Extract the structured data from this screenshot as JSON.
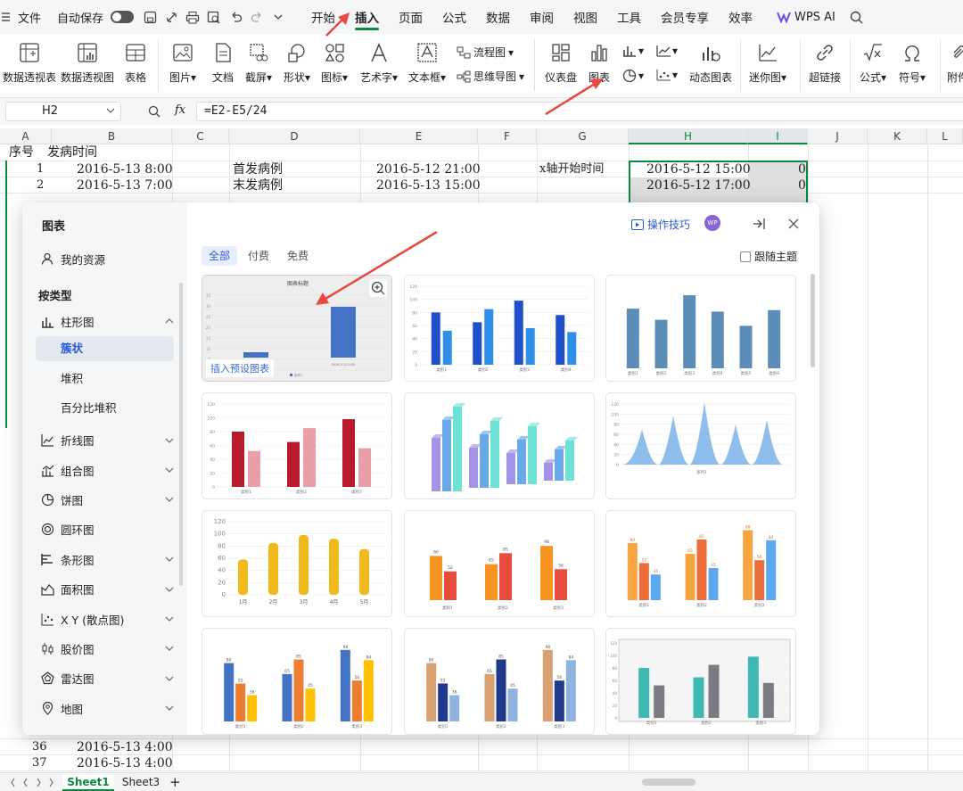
{
  "menubar": {
    "file": "文件",
    "autosave": "自动保存",
    "tabs": [
      "开始",
      "插入",
      "页面",
      "公式",
      "数据",
      "审阅",
      "视图",
      "工具",
      "会员专享",
      "效率"
    ],
    "active_tab": "插入",
    "wps_ai": "WPS AI"
  },
  "ribbon": {
    "pivot_table": "数据透视表",
    "pivot_chart": "数据透视图",
    "table": "表格",
    "picture": "图片",
    "document": "文档",
    "screenshot": "截屏",
    "shape": "形状",
    "icon": "图标",
    "art_text": "艺术字",
    "textbox": "文本框",
    "flowchart": "流程图",
    "mindmap": "思维导图",
    "dashboard": "仪表盘",
    "chart": "图表",
    "dynamic_chart": "动态图表",
    "sparkline": "迷你图",
    "hyperlink": "超链接",
    "formula": "公式",
    "symbol": "符号",
    "attachment": "附件"
  },
  "formula_bar": {
    "cell_ref": "H2",
    "fx": "fx",
    "formula": "=E2-E5/24"
  },
  "columns": [
    "A",
    "B",
    "C",
    "D",
    "E",
    "F",
    "G",
    "H",
    "I",
    "J",
    "K",
    "L"
  ],
  "cells": {
    "a1": "序号",
    "b1": "发病时间",
    "a2": "1",
    "b2": "2016-5-13  8:00",
    "d2": "首发病例",
    "e2": "2016-5-12 21:00",
    "g2": "x轴开始时间",
    "h2": "2016-5-12 15:00",
    "i2": "0",
    "a3": "2",
    "b3": "2016-5-13  7:00",
    "d3": "末发病例",
    "e3": "2016-5-13 15:00",
    "h3": "2016-5-12 17:00",
    "i3": "0",
    "a36": "36",
    "b36": "2016-5-13  4:00",
    "a37": "37",
    "b37": "2016-5-13  4:00"
  },
  "sheets": [
    "Sheet1",
    "Sheet3"
  ],
  "active_sheet": "Sheet1",
  "dialog": {
    "title": "图表",
    "my_resources": "我的资源",
    "by_type": "按类型",
    "tips": "操作技巧",
    "avatar": "WP",
    "follow_theme": "跟随主题",
    "insert_preset": "插入预设图表",
    "filters": [
      "全部",
      "付费",
      "免费"
    ],
    "categories": [
      {
        "label": "柱形图",
        "icon": "column-chart-icon",
        "expanded": true,
        "subs": [
          "簇状",
          "堆积",
          "百分比堆积"
        ]
      },
      {
        "label": "折线图",
        "icon": "line-chart-icon"
      },
      {
        "label": "组合图",
        "icon": "combo-chart-icon"
      },
      {
        "label": "饼图",
        "icon": "pie-chart-icon"
      },
      {
        "label": "圆环图",
        "icon": "donut-chart-icon"
      },
      {
        "label": "条形图",
        "icon": "bar-chart-icon"
      },
      {
        "label": "面积图",
        "icon": "area-chart-icon"
      },
      {
        "label": "X Y (散点图)",
        "icon": "scatter-chart-icon"
      },
      {
        "label": "股价图",
        "icon": "stock-chart-icon"
      },
      {
        "label": "雷达图",
        "icon": "radar-chart-icon"
      },
      {
        "label": "地图",
        "icon": "map-icon"
      }
    ],
    "active_sub": "簇状",
    "thumbnails": {
      "t1": {
        "title": "图表标题",
        "xlabel": "2016-5-13 0:00",
        "legend": "系列1"
      },
      "axis120": [
        "0",
        "20",
        "40",
        "60",
        "80",
        "100",
        "120"
      ],
      "months": [
        "1月",
        "2月",
        "3月",
        "4月",
        "5月"
      ],
      "cats4": [
        "类别1",
        "类别2",
        "类别3",
        "类别4"
      ],
      "cats3": [
        "类别1",
        "类别2",
        "类别3"
      ],
      "cats6": [
        "类别1",
        "类别2",
        "类别3",
        "类别4",
        "类别5",
        "类别6"
      ],
      "vals_a": [
        "80",
        "52",
        "36"
      ],
      "vals_b": [
        "65",
        "85",
        "45"
      ],
      "vals_c": [
        "98",
        "56",
        "84"
      ],
      "vals6": [
        "80",
        "65",
        "98",
        "76",
        "57",
        "78"
      ],
      "series1": "系列1"
    }
  }
}
